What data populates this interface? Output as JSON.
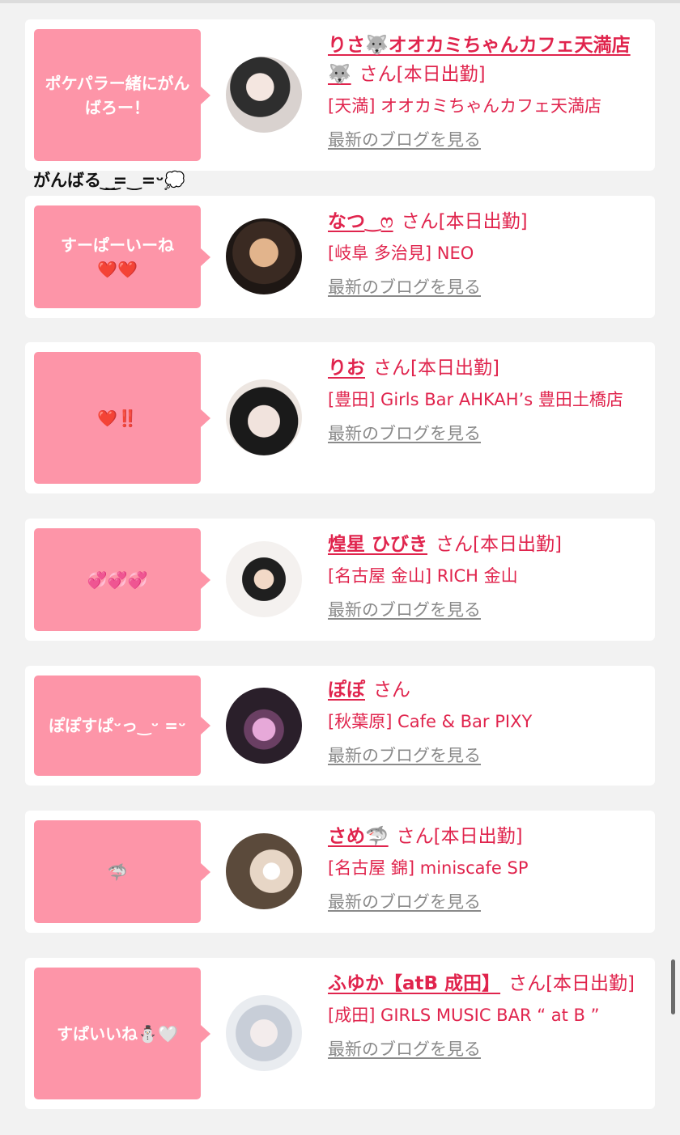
{
  "floating_comment": "がんばる ͜ ͜=‿=ᵕ💭",
  "blog_link_label": "最新のブログを見る",
  "san_label": "さん",
  "entries": [
    {
      "comment": "ポケパラー緒にがんばろー！",
      "name": "りさ🐺オオカミちゃんカフェ天満店🐺",
      "status": "[本日出勤]",
      "shop": "[天満] オオカミちゃんカフェ天満店",
      "avatar_colors": [
        "#3a3a3a",
        "#e8e0dc"
      ]
    },
    {
      "comment": "すーぱーいーね\n❤️❤️",
      "name": "なつ‿ෆ",
      "status": "[本日出勤]",
      "shop": "[岐阜 多治見] NEO",
      "avatar_colors": [
        "#2b1f1a",
        "#d8b08a"
      ]
    },
    {
      "comment": "❤️‼️",
      "name": "りお",
      "status": "[本日出勤]",
      "shop": "[豊田] Girls Bar AHKAH’s 豊田土橋店",
      "avatar_colors": [
        "#1d1d1d",
        "#efe6e2"
      ]
    },
    {
      "comment": "💞💞💞",
      "name": "煌星 ひびき",
      "status": "[本日出勤]",
      "shop": "[名古屋 金山] RICH 金山",
      "avatar_colors": [
        "#f3f0ef",
        "#2a2a2a"
      ]
    },
    {
      "comment": "ぽぽすぱᵕっ‿ᵕ =ᵕ",
      "name": "ぽぽ",
      "status": "",
      "shop": "[秋葉原] Cafe & Bar PIXY",
      "avatar_colors": [
        "#3b2a3a",
        "#d9a6d5"
      ]
    },
    {
      "comment": "🦈",
      "name": "さめ🦈",
      "status": "[本日出勤]",
      "shop": "[名古屋 錦] miniscafe SP",
      "avatar_colors": [
        "#5a4a3c",
        "#e3d6c8"
      ]
    },
    {
      "comment": "すぱいいね⛄🤍",
      "name": "ふゆか【atB 成田】",
      "status": "[本日出勤]",
      "shop": "[成田] GIRLS MUSIC BAR “ at B ”",
      "avatar_colors": [
        "#c9ced6",
        "#ffffff"
      ]
    }
  ]
}
